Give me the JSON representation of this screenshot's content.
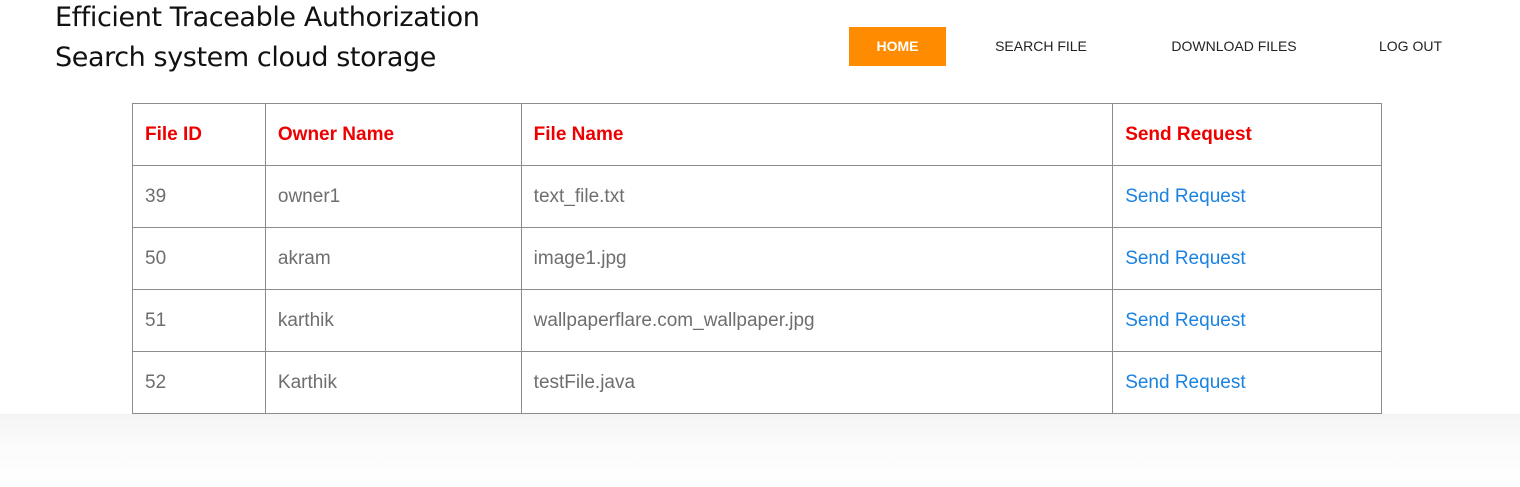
{
  "header": {
    "title_line1": "Efficient Traceable Authorization",
    "title_line2": "Search system cloud storage"
  },
  "nav": {
    "items": [
      {
        "label": "HOME",
        "active": true
      },
      {
        "label": "SEARCH FILE",
        "active": false
      },
      {
        "label": "DOWNLOAD FILES",
        "active": false
      },
      {
        "label": "LOG OUT",
        "active": false
      }
    ],
    "active_color": "#ff8c00"
  },
  "table": {
    "headers": [
      "File ID",
      "Owner Name",
      "File Name",
      "Send Request"
    ],
    "rows": [
      {
        "file_id": "39",
        "owner": "owner1",
        "file_name": "text_file.txt",
        "action": "Send Request"
      },
      {
        "file_id": "50",
        "owner": "akram",
        "file_name": "image1.jpg",
        "action": "Send Request"
      },
      {
        "file_id": "51",
        "owner": "karthik",
        "file_name": "wallpaperflare.com_wallpaper.jpg",
        "action": "Send Request"
      },
      {
        "file_id": "52",
        "owner": "Karthik",
        "file_name": "testFile.java",
        "action": "Send Request"
      }
    ],
    "header_color": "#ee0000",
    "link_color": "#1a82e0"
  }
}
